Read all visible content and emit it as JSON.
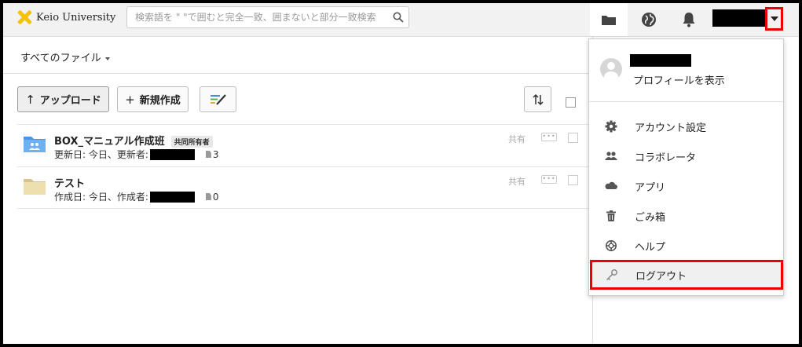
{
  "header": {
    "logo_text": "Keio University",
    "search_placeholder": "検索語を \" \"で囲むと完全一致、囲まないと部分一致検索"
  },
  "subheader": {
    "all_files_label": "すべてのファイル"
  },
  "toolbar": {
    "upload_label": "アップロード",
    "new_label": "新規作成"
  },
  "files": [
    {
      "name": "BOX_マニュアル作成班",
      "badge": "共同所有者",
      "meta_prefix": "更新日: 今日、更新者:",
      "count": "3",
      "share_label": "共有",
      "folder_type": "shared"
    },
    {
      "name": "テスト",
      "badge": "",
      "meta_prefix": "作成日: 今日、作成者:",
      "count": "0",
      "share_label": "共有",
      "folder_type": "plain"
    }
  ],
  "menu": {
    "profile_link": "プロフィールを表示",
    "items": [
      {
        "label": "アカウント設定",
        "icon": "gear-icon"
      },
      {
        "label": "コラボレータ",
        "icon": "collaborators-icon"
      },
      {
        "label": "アプリ",
        "icon": "cloud-icon"
      },
      {
        "label": "ごみ箱",
        "icon": "trash-icon"
      },
      {
        "label": "ヘルプ",
        "icon": "lifebuoy-icon"
      },
      {
        "label": "ログアウト",
        "icon": "key-icon"
      }
    ]
  },
  "colors": {
    "highlight_red": "#e00000",
    "logo_yellow": "#f4c20d",
    "folder_blue": "#5aa0e6",
    "folder_tan": "#e9d9a6"
  }
}
